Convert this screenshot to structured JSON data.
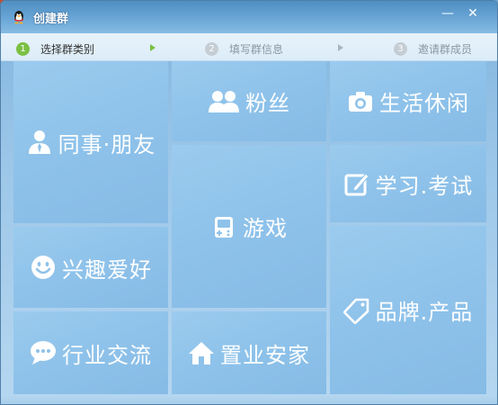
{
  "window": {
    "title": "创建群",
    "minimize_symbol": "—",
    "close_symbol": "✕"
  },
  "steps": [
    {
      "number": "1",
      "label": "选择群类别",
      "state": "active"
    },
    {
      "number": "2",
      "label": "填写群信息",
      "state": "inactive"
    },
    {
      "number": "3",
      "label": "邀请群成员",
      "state": "inactive"
    }
  ],
  "categories": [
    {
      "id": "colleague",
      "label": "同事·朋友",
      "icon": "person-icon"
    },
    {
      "id": "fans",
      "label": "粉丝",
      "icon": "people-icon"
    },
    {
      "id": "life",
      "label": "生活休闲",
      "icon": "camera-icon"
    },
    {
      "id": "game",
      "label": "游戏",
      "icon": "gamepad-icon"
    },
    {
      "id": "study",
      "label": "学习.考试",
      "icon": "edit-icon"
    },
    {
      "id": "interest",
      "label": "兴趣爱好",
      "icon": "smiley-icon"
    },
    {
      "id": "brand",
      "label": "品牌.产品",
      "icon": "tag-icon"
    },
    {
      "id": "industry",
      "label": "行业交流",
      "icon": "chat-bubble-icon"
    },
    {
      "id": "realestate",
      "label": "置业安家",
      "icon": "house-icon"
    }
  ],
  "colors": {
    "tile_bg": "#8ec2ea",
    "tile_text": "#ffffff",
    "step_active": "#7bc043",
    "step_inactive": "#c5cdd4"
  }
}
